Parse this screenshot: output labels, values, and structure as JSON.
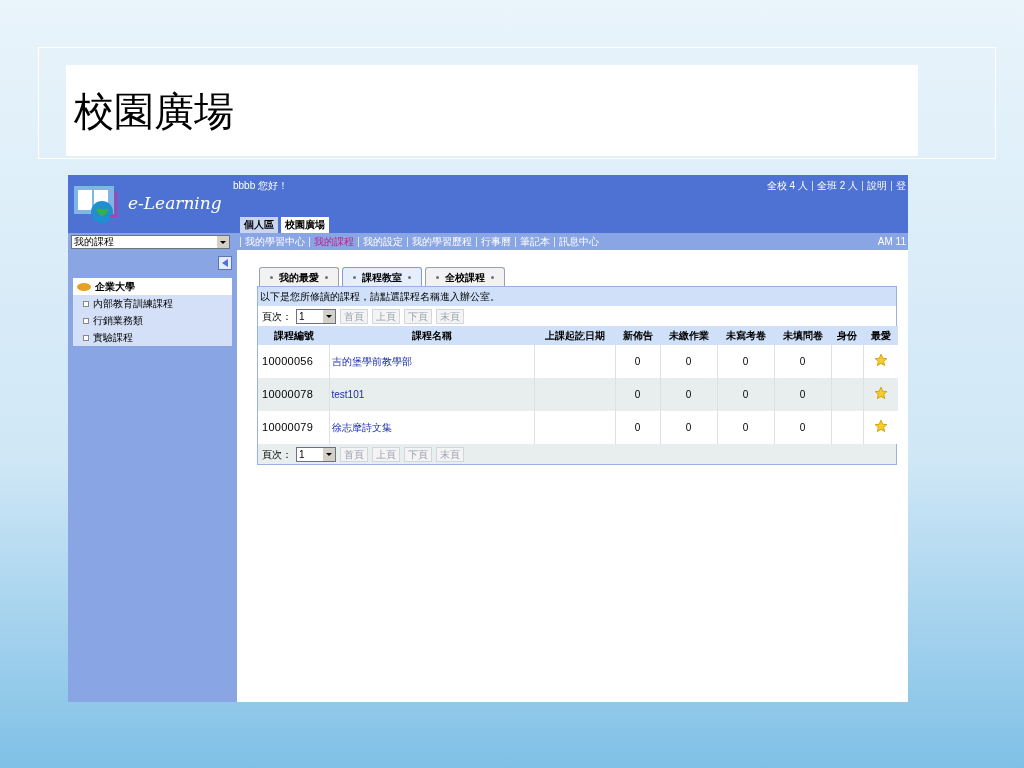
{
  "slide": {
    "title": "校園廣場"
  },
  "app": {
    "logo_text": "e-Learning",
    "greeting": "bbbb 您好！",
    "top_links": [
      "全校 4 人",
      "全班 2 人",
      "說明",
      "登"
    ],
    "area_tabs": [
      {
        "label": "個人區",
        "selected": false
      },
      {
        "label": "校園廣場",
        "selected": true
      }
    ],
    "menu": [
      {
        "label": "我的學習中心",
        "selected": false
      },
      {
        "label": "我的課程",
        "selected": true
      },
      {
        "label": "我的設定",
        "selected": false
      },
      {
        "label": "我的學習歷程",
        "selected": false
      },
      {
        "label": "行事曆",
        "selected": false
      },
      {
        "label": "筆記本",
        "selected": false
      },
      {
        "label": "訊息中心",
        "selected": false
      }
    ],
    "clock": "AM 11",
    "sidebar": {
      "select_value": "我的課程",
      "tree": [
        {
          "label": "企業大學",
          "expanded": true,
          "children": [
            {
              "label": "內部教育訓練課程"
            },
            {
              "label": "行銷業務類"
            },
            {
              "label": "實驗課程"
            }
          ]
        }
      ]
    },
    "course_tabs": [
      {
        "label": "我的最愛",
        "selected": false
      },
      {
        "label": "課程教室",
        "selected": true
      },
      {
        "label": "全校課程",
        "selected": false
      }
    ],
    "notice": "以下是您所修讀的課程，請點選課程名稱進入辦公室。",
    "pager": {
      "label": "頁次：",
      "page": "1",
      "buttons": [
        "首頁",
        "上頁",
        "下頁",
        "末頁"
      ]
    },
    "table": {
      "columns": [
        "課程編號",
        "課程名稱",
        "上課起訖日期",
        "新佈告",
        "未繳作業",
        "未寫考卷",
        "未填問卷",
        "身份",
        "最愛"
      ],
      "rows": [
        {
          "id": "10000056",
          "name": "吉的堡學前教學部",
          "new_posts": "0",
          "homework": "0",
          "exams": "0",
          "surveys": "0",
          "favorite": true
        },
        {
          "id": "10000078",
          "name": "test101",
          "new_posts": "0",
          "homework": "0",
          "exams": "0",
          "surveys": "0",
          "favorite": true
        },
        {
          "id": "10000079",
          "name": "徐志摩詩文集",
          "new_posts": "0",
          "homework": "0",
          "exams": "0",
          "surveys": "0",
          "favorite": true
        }
      ]
    },
    "pager_bottom": {
      "label": "頁次：",
      "page": "1",
      "buttons": [
        "首頁",
        "上頁",
        "下頁",
        "末頁"
      ]
    }
  }
}
